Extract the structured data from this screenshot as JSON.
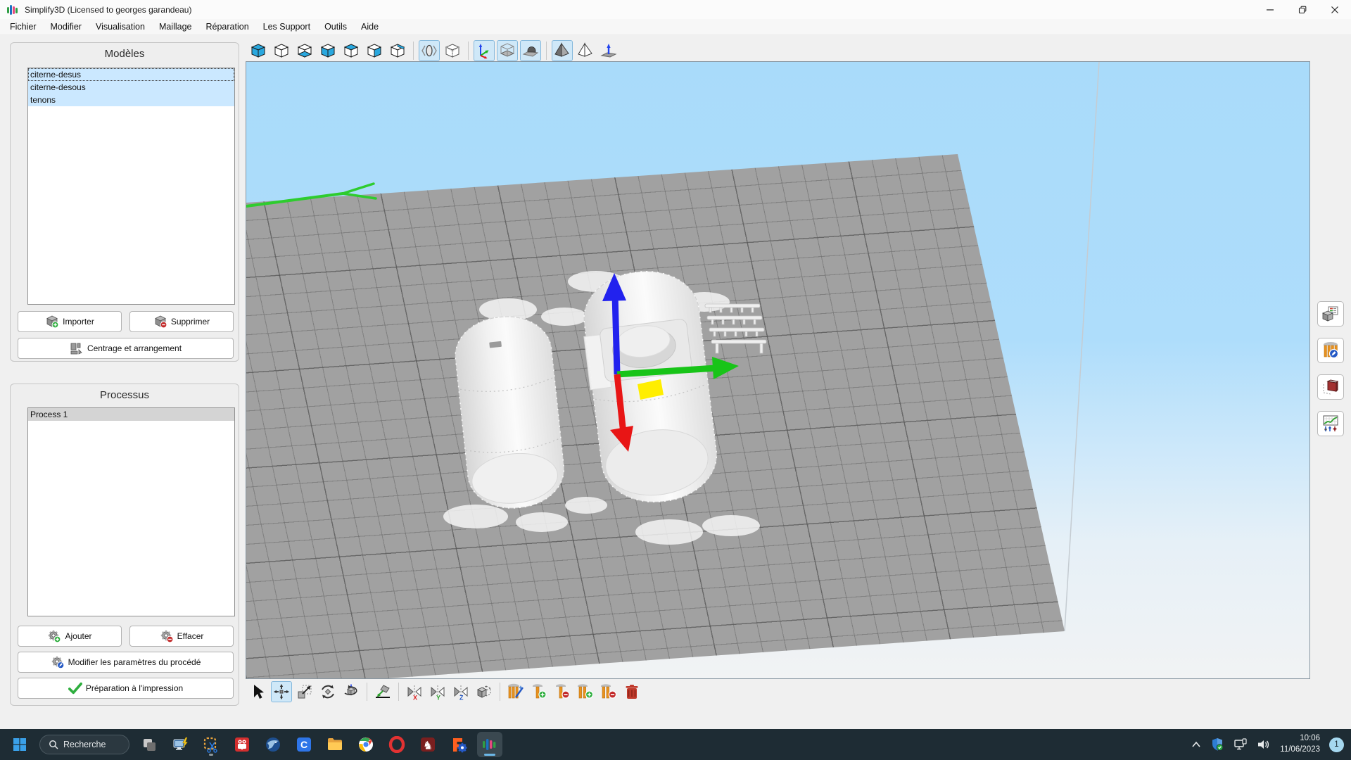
{
  "window": {
    "title": "Simplify3D (Licensed to georges garandeau)",
    "controls": [
      "minimize",
      "restore",
      "close"
    ]
  },
  "menu": {
    "items": [
      "Fichier",
      "Modifier",
      "Visualisation",
      "Maillage",
      "Réparation",
      "Les Support",
      "Outils",
      "Aide"
    ]
  },
  "panels": {
    "models": {
      "title": "Modèles",
      "items": [
        "citerne-desus",
        "citerne-desous",
        "tenons"
      ],
      "buttons": {
        "import": "Importer",
        "remove": "Supprimer",
        "center": "Centrage et arrangement"
      }
    },
    "processes": {
      "title": "Processus",
      "items": [
        "Process 1"
      ],
      "buttons": {
        "add": "Ajouter",
        "clear": "Effacer",
        "edit": "Modifier les paramètres du procédé",
        "prepare": "Préparation à l'impression"
      }
    }
  },
  "toolbar_top": {
    "icons": [
      "view-default-cube-icon",
      "view-front-cube-icon",
      "view-bottom-cube-icon",
      "view-left-cube-icon",
      "view-top-cube-icon",
      "view-right-cube-icon",
      "view-back-cube-icon",
      "cross-section-icon",
      "wireframe-cube-icon",
      "axes-gizmo-icon",
      "build-volume-icon",
      "bed-model-icon",
      "solid-pyramid-icon",
      "outline-pyramid-icon",
      "z-arrow-plate-icon"
    ],
    "active": [
      "cross-section-icon",
      "axes-gizmo-icon",
      "build-volume-icon",
      "bed-model-icon",
      "solid-pyramid-icon"
    ]
  },
  "toolbar_bottom": {
    "icons": [
      "select-cursor-icon",
      "move-tool-icon",
      "scale-tool-icon",
      "rotate-tool-icon",
      "free-rotate-icon",
      "lay-flat-icon",
      "mirror-x-icon",
      "mirror-y-icon",
      "mirror-z-icon",
      "duplicate-model-icon",
      "generate-supports-icon",
      "add-support-icon",
      "remove-support-icon",
      "add-support-group-icon",
      "remove-support-group-icon",
      "delete-all-supports-icon"
    ],
    "active": [
      "move-tool-icon"
    ],
    "mirror_labels": {
      "x": "X",
      "y": "Y",
      "z": "Z"
    }
  },
  "toolbar_right": {
    "icons": [
      "model-properties-icon",
      "edit-supports-icon",
      "cross-section-tool-icon",
      "tuning-graph-icon"
    ]
  },
  "viewport": {
    "models_shown": [
      "citerne-desus",
      "citerne-desous",
      "tenons"
    ],
    "gizmo_colors": {
      "x": "#e81515",
      "y": "#18c418",
      "z": "#2222ee"
    },
    "sticker_color": "#ffee00",
    "bed_arrow_color": "#2ecc2e"
  },
  "taskbar": {
    "search_placeholder": "Recherche",
    "icons": [
      "start-icon",
      "search-icon",
      "stack-windows-icon",
      "pc-install-icon",
      "snipping-tool-icon",
      "video-downloader-icon",
      "thunderbird-icon",
      "c-app-icon",
      "file-explorer-icon",
      "chrome-icon",
      "opera-icon",
      "knight-app-icon",
      "freecad-icon",
      "simplify3d-icon"
    ],
    "running_apps": [
      "snipping-tool-icon"
    ],
    "active_app": "simplify3d-icon",
    "tray_icons": [
      "tray-chevron-icon",
      "security-shield-icon",
      "network-display-icon",
      "speaker-icon"
    ],
    "clock": {
      "time": "10:06",
      "date": "11/06/2023"
    },
    "notification_count": "1"
  },
  "colors": {
    "toggle_active_bg": "#cfe8f8",
    "selection_blue": "#cbe8ff",
    "selection_gray": "#d4d4d4",
    "taskbar_bg": "#1e2c34",
    "viewport_sky": "#aeddfb",
    "plate_gray": "#a1a1a1",
    "support_orange": "#e8921e",
    "view_cube_blue": "#29a8df"
  }
}
